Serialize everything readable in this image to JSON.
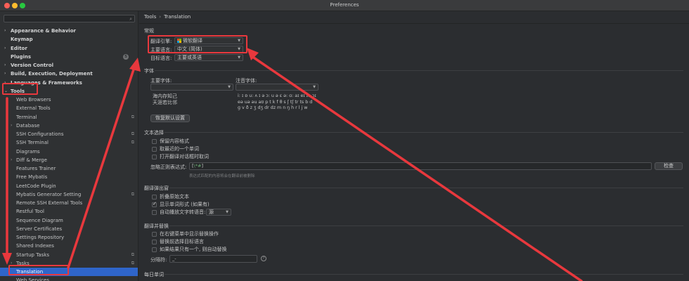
{
  "window": {
    "title": "Preferences"
  },
  "search": {
    "placeholder": ""
  },
  "sidebar": {
    "items": [
      {
        "label": "Appearance & Behavior",
        "level": 0,
        "bold": true,
        "arrow": "›"
      },
      {
        "label": "Keymap",
        "level": 0,
        "bold": true
      },
      {
        "label": "Editor",
        "level": 0,
        "bold": true,
        "arrow": "›"
      },
      {
        "label": "Plugins",
        "level": 0,
        "bold": true,
        "badge": "5"
      },
      {
        "label": "Version Control",
        "level": 0,
        "bold": true,
        "arrow": "›"
      },
      {
        "label": "Build, Execution, Deployment",
        "level": 0,
        "bold": true,
        "arrow": "›"
      },
      {
        "label": "Languages & Frameworks",
        "level": 0,
        "bold": true,
        "arrow": "›"
      },
      {
        "label": "Tools",
        "level": 0,
        "bold": true,
        "arrow": "⌄"
      },
      {
        "label": "Web Browsers",
        "level": 1
      },
      {
        "label": "External Tools",
        "level": 1
      },
      {
        "label": "Terminal",
        "level": 1,
        "right_icon": "⧉"
      },
      {
        "label": "Database",
        "level": 1,
        "arrow": "›"
      },
      {
        "label": "SSH Configurations",
        "level": 1,
        "right_icon": "⧉"
      },
      {
        "label": "SSH Terminal",
        "level": 1,
        "right_icon": "⧉"
      },
      {
        "label": "Diagrams",
        "level": 1
      },
      {
        "label": "Diff & Merge",
        "level": 1,
        "arrow": "›"
      },
      {
        "label": "Features Trainer",
        "level": 1
      },
      {
        "label": "Free Mybatis",
        "level": 1
      },
      {
        "label": "LeetCode Plugin",
        "level": 1
      },
      {
        "label": "Mybatis Generator Setting",
        "level": 1,
        "right_icon": "⧉"
      },
      {
        "label": "Remote SSH External Tools",
        "level": 1
      },
      {
        "label": "Restful Tool",
        "level": 1
      },
      {
        "label": "Sequence Diagram",
        "level": 1
      },
      {
        "label": "Server Certificates",
        "level": 1
      },
      {
        "label": "Settings Repository",
        "level": 1
      },
      {
        "label": "Shared Indexes",
        "level": 1
      },
      {
        "label": "Startup Tasks",
        "level": 1,
        "right_icon": "⧉"
      },
      {
        "label": "Tasks",
        "level": 1,
        "arrow": "›",
        "right_icon": "⧉"
      },
      {
        "label": "Translation",
        "level": 1,
        "selected": true
      },
      {
        "label": "Web Services",
        "level": 1
      }
    ]
  },
  "breadcrumb": {
    "parent": "Tools",
    "separator": "›",
    "current": "Translation"
  },
  "general": {
    "title": "常规",
    "engine_label": "翻译引擎:",
    "engine_value": "微软翻译",
    "primary_label": "主要语言:",
    "primary_value": "中文 (简体)",
    "target_label": "目标语言:",
    "target_value": "主要或英语"
  },
  "font": {
    "title": "字体",
    "primary_label": "主要字体:",
    "phonetic_label": "注音字体:",
    "primary_preview": [
      "海内存知己",
      "天涯若比邻"
    ],
    "phonetic_preview": [
      "i: ɪ ɒ u: ʌ ɪ ə ɔ: u ə ɛ ə: ɑ: aɪ eɪ ɪə ɔɪ",
      "eə uə əu aʊ p t k f θ s ʃ tʃ tr ts b d",
      "g v ð z ʒ dʒ dr dz m n ŋ h r l j w"
    ],
    "restore_button": "恢复默认设置"
  },
  "text_selection": {
    "title": "文本选择",
    "options": [
      {
        "label": "保留内容格式",
        "checked": false
      },
      {
        "label": "取最近的一个单词",
        "checked": false
      },
      {
        "label": "打开翻译对话框时取词",
        "checked": false
      }
    ],
    "ignore_label": "忽略正则表达式:",
    "regex_open": "[",
    "regex_inner": "\\*#",
    "regex_close": "]",
    "check_button": "检查",
    "hint": "表达式匹配的内容将会在翻译前被删除"
  },
  "popup": {
    "title": "翻译弹出窗",
    "options": [
      {
        "label": "折叠原始文本",
        "checked": false
      },
      {
        "label": "显示单词形式 (如果有)",
        "checked": true
      },
      {
        "label": "自动播放文字转语音:",
        "checked": false
      }
    ],
    "tts_value": "源"
  },
  "replace": {
    "title": "翻译并替换",
    "options": [
      {
        "label": "在右键菜单中显示替换操作",
        "checked": false
      },
      {
        "label": "替换前选择目标语言",
        "checked": false
      },
      {
        "label": "如果结果只有一个, 则自动替换",
        "checked": false
      }
    ],
    "separator_label": "分隔符:",
    "separator_value": "_-",
    "help_glyph": "?"
  },
  "daily": {
    "title": "每日单词"
  },
  "colors": {
    "accent": "#2f65ca",
    "annotation": "#e8383d",
    "background": "#2b2d30"
  }
}
